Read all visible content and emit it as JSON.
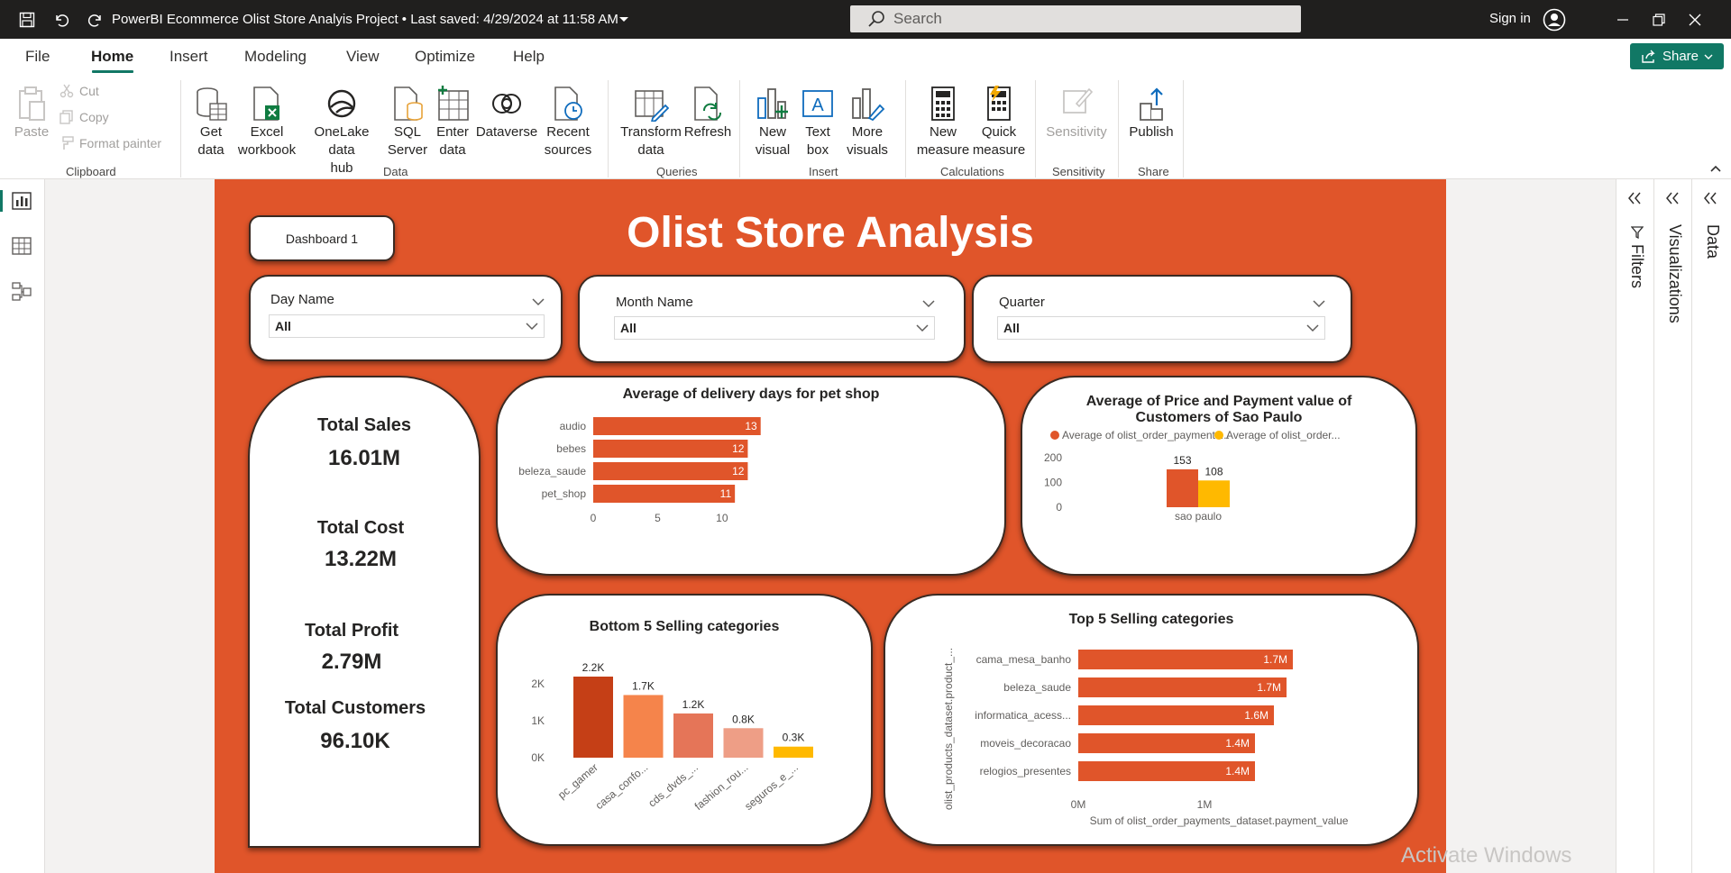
{
  "titlebar": {
    "title": "PowerBI Ecommerce Olist Store Analyis Project  •  Last saved: 4/29/2024 at 11:58 AM",
    "search_placeholder": "Search",
    "signin": "Sign in"
  },
  "menu": [
    "File",
    "Home",
    "Insert",
    "Modeling",
    "View",
    "Optimize",
    "Help"
  ],
  "share_label": "Share",
  "ribbon": {
    "clipboard": {
      "paste": "Paste",
      "cut": "Cut",
      "copy": "Copy",
      "format_painter": "Format painter",
      "group": "Clipboard"
    },
    "data": {
      "get_data": "Get\ndata",
      "excel": "Excel\nworkbook",
      "onelake": "OneLake data\nhub",
      "sql": "SQL\nServer",
      "enter": "Enter\ndata",
      "dataverse": "Dataverse",
      "recent": "Recent\nsources",
      "group": "Data"
    },
    "queries": {
      "transform": "Transform\ndata",
      "refresh": "Refresh",
      "group": "Queries"
    },
    "insert": {
      "new_visual": "New\nvisual",
      "text_box": "Text\nbox",
      "more_visuals": "More\nvisuals",
      "group": "Insert"
    },
    "calculations": {
      "new_measure": "New\nmeasure",
      "quick_measure": "Quick\nmeasure",
      "group": "Calculations"
    },
    "sensitivity": {
      "label": "Sensitivity",
      "group": "Sensitivity"
    },
    "share": {
      "publish": "Publish",
      "group": "Share"
    }
  },
  "panes": {
    "filters": "Filters",
    "visualizations": "Visualizations",
    "data": "Data"
  },
  "report": {
    "title": "Olist Store Analysis",
    "dashboard_button": "Dashboard 1",
    "slicers": [
      {
        "title": "Day Name",
        "value": "All"
      },
      {
        "title": "Month Name",
        "value": "All"
      },
      {
        "title": "Quarter",
        "value": "All"
      }
    ],
    "kpis": [
      {
        "label": "Total Sales",
        "value": "16.01M"
      },
      {
        "label": "Total Cost",
        "value": "13.22M"
      },
      {
        "label": "Total Profit",
        "value": "2.79M"
      },
      {
        "label": "Total Customers",
        "value": "96.10K"
      }
    ]
  },
  "chart_data": [
    {
      "type": "bar",
      "orientation": "horizontal",
      "title": "Average of delivery days for pet shop",
      "categories": [
        "audio",
        "bebes",
        "beleza_saude",
        "pet_shop"
      ],
      "values": [
        13,
        12,
        12,
        11
      ],
      "data_labels": [
        "13",
        "12",
        "12",
        "11"
      ],
      "xticks": [
        "0",
        "5",
        "10"
      ],
      "xlim": [
        0,
        14
      ],
      "color": "#e0552a"
    },
    {
      "type": "bar",
      "title": "Average of Price and Payment value of Customers of Sao Paulo",
      "categories": [
        "sao paulo"
      ],
      "series": [
        {
          "name": "Average of olist_order_payments...",
          "values": [
            153
          ],
          "color": "#e0552a"
        },
        {
          "name": "Average of olist_order...",
          "values": [
            108
          ],
          "color": "#ffb900"
        }
      ],
      "yticks": [
        "0",
        "100",
        "200"
      ],
      "ylim": [
        0,
        200
      ],
      "legend": "top"
    },
    {
      "type": "bar",
      "title": "Bottom 5 Selling categories",
      "categories": [
        "pc_gamer",
        "casa_confo...",
        "cds_dvds_...",
        "fashion_rou...",
        "seguros_e_..."
      ],
      "values": [
        2200,
        1700,
        1200,
        800,
        300
      ],
      "data_labels": [
        "2.2K",
        "1.7K",
        "1.2K",
        "0.8K",
        "0.3K"
      ],
      "colors": [
        "#c53f16",
        "#f5844b",
        "#e57558",
        "#ee9e86",
        "#ffb900"
      ],
      "yticks": [
        "0K",
        "1K",
        "2K"
      ],
      "ylim": [
        0,
        2200
      ]
    },
    {
      "type": "bar",
      "orientation": "horizontal",
      "title": "Top 5 Selling categories",
      "categories": [
        "cama_mesa_banho",
        "beleza_saude",
        "informatica_acess...",
        "moveis_decoracao",
        "relogios_presentes"
      ],
      "values": [
        1.7,
        1.65,
        1.55,
        1.4,
        1.4
      ],
      "data_labels": [
        "1.7M",
        "1.7M",
        "1.6M",
        "1.4M",
        "1.4M"
      ],
      "xticks": [
        "0M",
        "1M"
      ],
      "xlim": [
        0,
        1.9
      ],
      "xlabel": "Sum of olist_order_payments_dataset.payment_value",
      "ylabel": "olist_products_dataset.product_...",
      "color": "#e0552a"
    }
  ],
  "watermark": "Activate Windows"
}
